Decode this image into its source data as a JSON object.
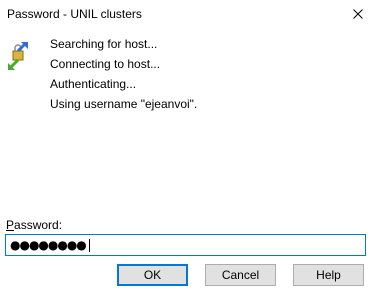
{
  "window": {
    "title": "Password - UNIL clusters"
  },
  "icons": {
    "app": "transfer-arrows-lock-icon",
    "close": "close-icon"
  },
  "log": [
    "Searching for host...",
    "Connecting to host...",
    "Authenticating...",
    "Using username \"ejeanvoi\"."
  ],
  "password": {
    "label_accel": "P",
    "label_rest": "assword:",
    "masked_value": "●●●●●●●●"
  },
  "buttons": {
    "ok": "OK",
    "cancel": "Cancel",
    "help": "Help"
  },
  "colors": {
    "accent": "#0078d7",
    "button_bg": "#e1e1e1",
    "button_border": "#adadad"
  }
}
